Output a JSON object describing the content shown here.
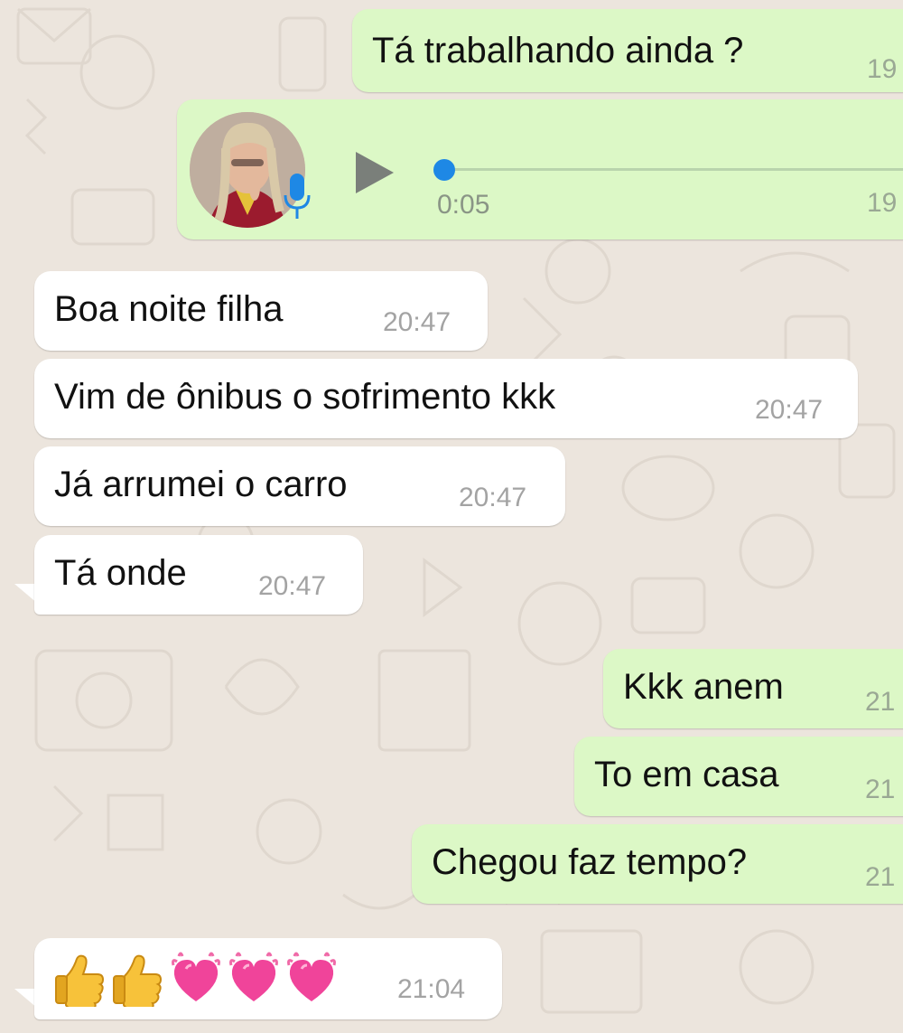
{
  "conversation": {
    "messages": [
      {
        "id": "m1",
        "direction": "outgoing",
        "text": "Tá trabalhando ainda ?",
        "time": "19"
      },
      {
        "id": "m2",
        "direction": "outgoing",
        "type": "voice",
        "duration": "0:05",
        "time": "19",
        "playback_progress": 0
      },
      {
        "id": "m3",
        "direction": "incoming",
        "text": "Boa noite filha",
        "time": "20:47"
      },
      {
        "id": "m4",
        "direction": "incoming",
        "text": "Vim de ônibus o sofrimento kkk",
        "time": "20:47"
      },
      {
        "id": "m5",
        "direction": "incoming",
        "text": "Já arrumei o carro",
        "time": "20:47"
      },
      {
        "id": "m6",
        "direction": "incoming",
        "text": "Tá onde",
        "time": "20:47"
      },
      {
        "id": "m7",
        "direction": "outgoing",
        "text": "Kkk anem",
        "time": "21"
      },
      {
        "id": "m8",
        "direction": "outgoing",
        "text": "To em casa",
        "time": "21"
      },
      {
        "id": "m9",
        "direction": "outgoing",
        "text": "Chegou faz tempo?",
        "time": "21"
      },
      {
        "id": "m10",
        "direction": "incoming",
        "type": "emoji",
        "emojis": [
          "thumbs-up",
          "thumbs-up",
          "growing-heart",
          "growing-heart",
          "growing-heart"
        ],
        "time": "21:04"
      }
    ]
  },
  "colors": {
    "outgoing_bubble": "#dcf8c6",
    "incoming_bubble": "#ffffff",
    "background": "#ece5dd",
    "voice_knob": "#1e88e5",
    "mic_icon": "#1e88e5"
  }
}
